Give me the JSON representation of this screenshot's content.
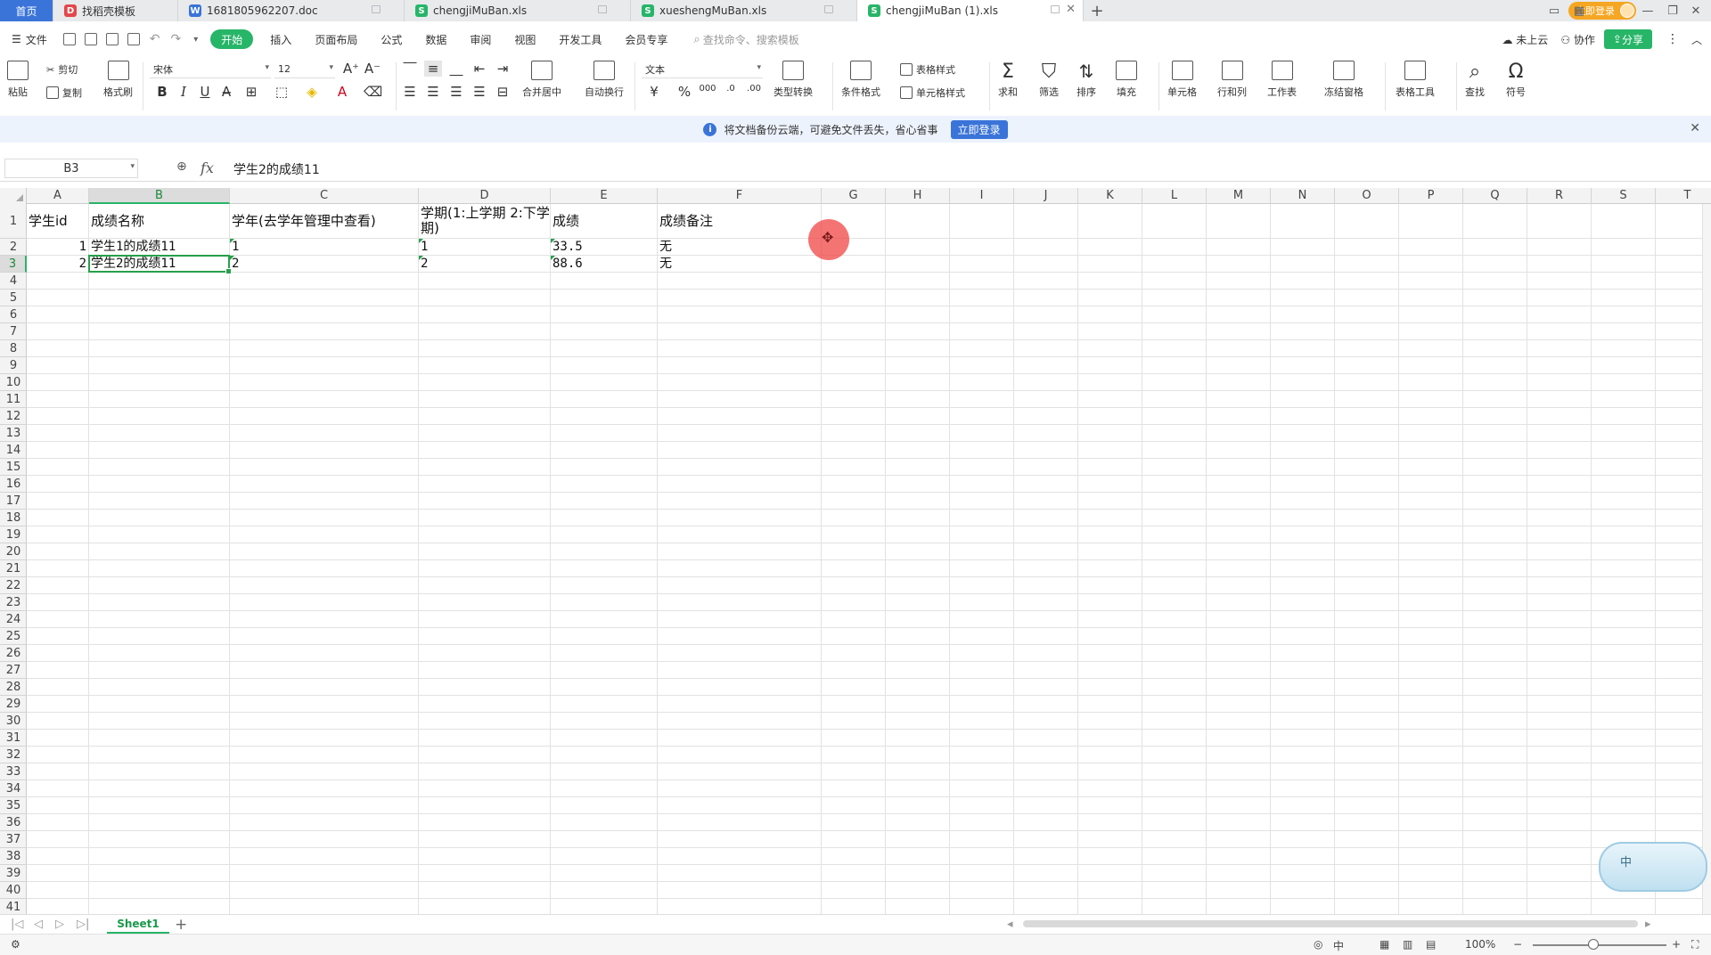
{
  "tabs": [
    {
      "label": "首页",
      "kind": "home"
    },
    {
      "label": "找稻壳模板",
      "icon_color": "#e2474b",
      "icon": "D"
    },
    {
      "label": "1681805962207.doc",
      "icon_color": "#3a74d8",
      "icon": "W"
    },
    {
      "label": "chengjiMuBan.xls",
      "icon_color": "#27b568",
      "icon": "S"
    },
    {
      "label": "xueshengMuBan.xls",
      "icon_color": "#27b568",
      "icon": "S"
    },
    {
      "label": "chengjiMuBan (1).xls",
      "icon_color": "#27b568",
      "icon": "S",
      "active": true
    }
  ],
  "titlebar": {
    "login_label": "立即登录"
  },
  "menu": {
    "file": "文件",
    "items": [
      "开始",
      "插入",
      "页面布局",
      "公式",
      "数据",
      "审阅",
      "视图",
      "开发工具",
      "会员专享"
    ],
    "active_index": 0,
    "search_placeholder": "查找命令、搜索模板",
    "cloud": "未上云",
    "collab": "协作",
    "share": "分享"
  },
  "ribbon": {
    "paste": "粘贴",
    "cut": "剪切",
    "copy": "复制",
    "format_painter": "格式刷",
    "font_name": "宋体",
    "font_size": "12",
    "merge": "合并居中",
    "wrap": "自动换行",
    "number_format": "文本",
    "type_convert": "类型转换",
    "cond_format": "条件格式",
    "table_style": "表格样式",
    "cell_style": "单元格样式",
    "sum": "求和",
    "filter": "筛选",
    "sort": "排序",
    "fill": "填充",
    "cell": "单元格",
    "rowcol": "行和列",
    "worksheet": "工作表",
    "freeze": "冻结窗格",
    "table_tools": "表格工具",
    "find": "查找",
    "symbol": "符号",
    "bold": "B",
    "italic": "I",
    "underline": "U"
  },
  "notify": {
    "text": "将文档备份云端，可避免文件丢失，省心省事",
    "button": "立即登录"
  },
  "formula_bar": {
    "name_box": "B3",
    "fx": "fx",
    "content": "学生2的成绩11"
  },
  "columns": [
    "A",
    "B",
    "C",
    "D",
    "E",
    "F",
    "G",
    "H",
    "I",
    "J",
    "K",
    "L",
    "M",
    "N",
    "O",
    "P",
    "Q",
    "R",
    "S",
    "T"
  ],
  "selected_column": "B",
  "selected_row": 3,
  "row_count": 41,
  "cells": {
    "A1": "学生id",
    "B1": "成绩名称",
    "C1": "学年(去学年管理中查看)",
    "D1": "学期(1:上学期 2:下学期)",
    "E1": "成绩",
    "F1": "成绩备注",
    "A2": "1",
    "B2": "学生1的成绩11",
    "C2": "1",
    "D2": "1",
    "E2": "33.5",
    "F2": "无",
    "A3": "2",
    "B3": "学生2的成绩11",
    "C3": "2",
    "D3": "2",
    "E3": "88.6",
    "F3": "无"
  },
  "ime": {
    "label": "中"
  },
  "sheet": {
    "name": "Sheet1"
  },
  "status": {
    "zoom": "100%",
    "input_mode": "中"
  }
}
